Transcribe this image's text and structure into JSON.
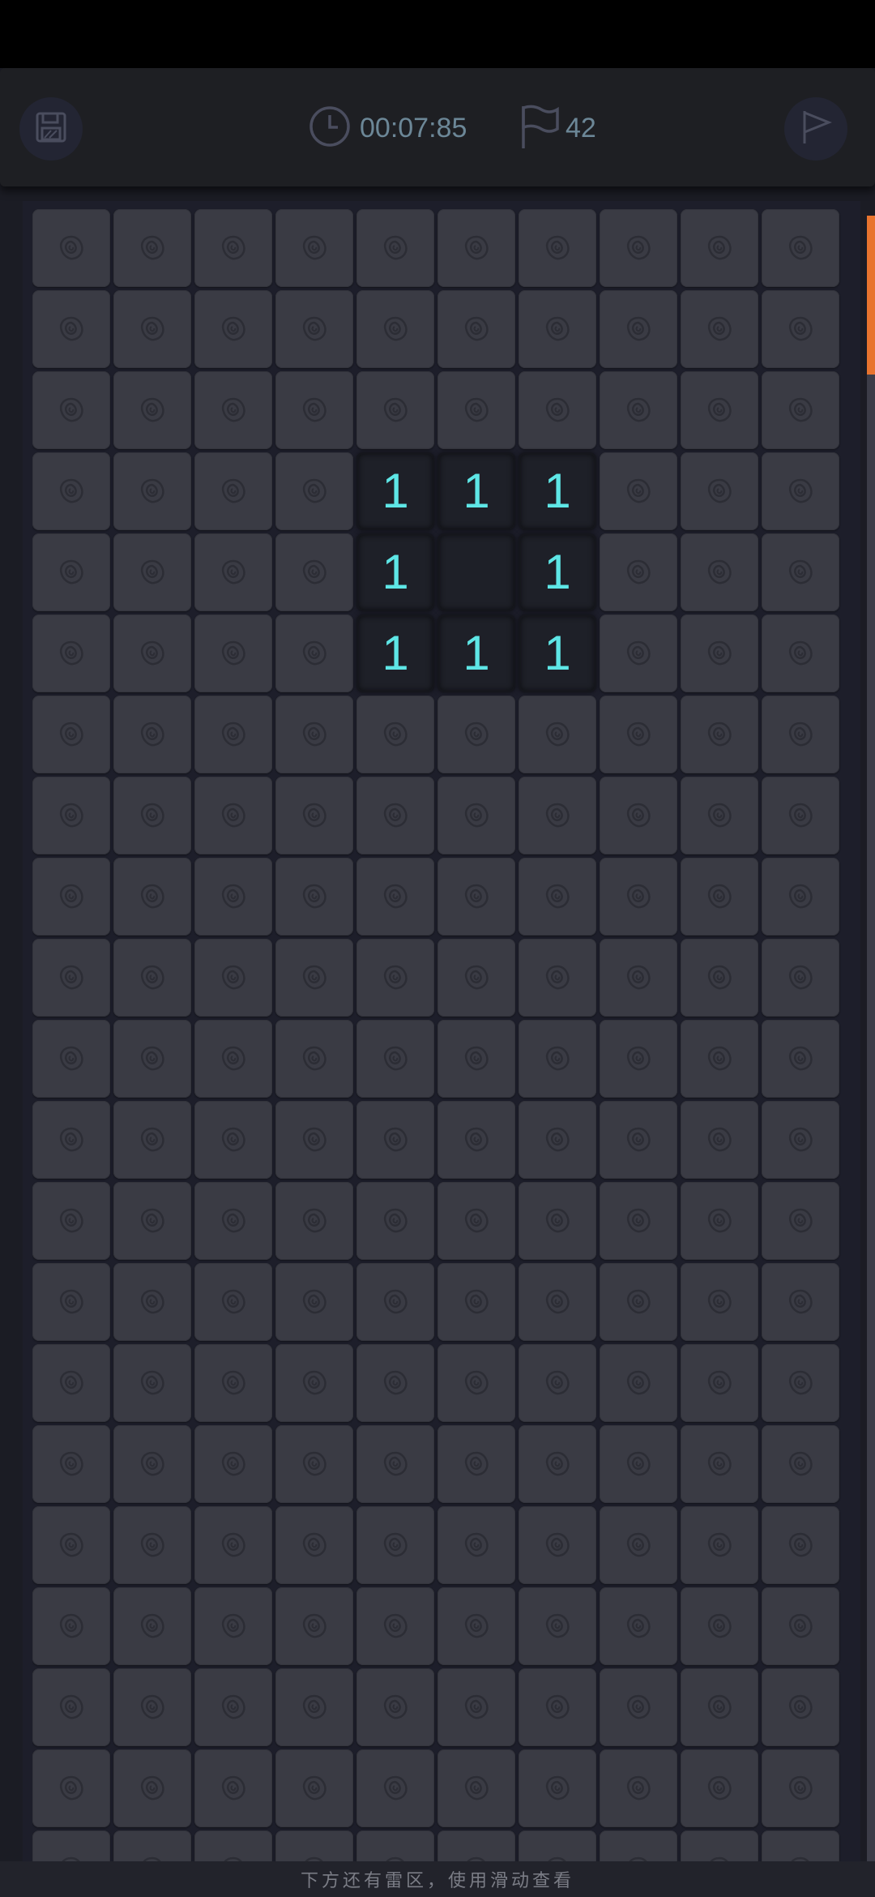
{
  "header": {
    "timer": "00:07:85",
    "flag_count": "42",
    "save_icon": "floppy-disk-icon",
    "timer_icon": "clock-icon",
    "flag_icon": "flag-icon",
    "mode_icon": "flag-mode-icon"
  },
  "board": {
    "columns": 10,
    "tile_icon": "rose-icon",
    "revealed": [
      {
        "row": 3,
        "col": 4,
        "value": "1"
      },
      {
        "row": 3,
        "col": 5,
        "value": "1"
      },
      {
        "row": 3,
        "col": 6,
        "value": "1"
      },
      {
        "row": 4,
        "col": 4,
        "value": "1"
      },
      {
        "row": 4,
        "col": 5,
        "value": ""
      },
      {
        "row": 4,
        "col": 6,
        "value": "1"
      },
      {
        "row": 5,
        "col": 4,
        "value": "1"
      },
      {
        "row": 5,
        "col": 5,
        "value": "1"
      },
      {
        "row": 5,
        "col": 6,
        "value": "1"
      }
    ]
  },
  "footer": {
    "hint": "下方还有雷区，使用滑动查看"
  },
  "colors": {
    "number": "#5ee6e6",
    "scroll_thumb": "#e8742e",
    "closed_tile": "#3a3b44",
    "open_tile": "#1e2028"
  }
}
